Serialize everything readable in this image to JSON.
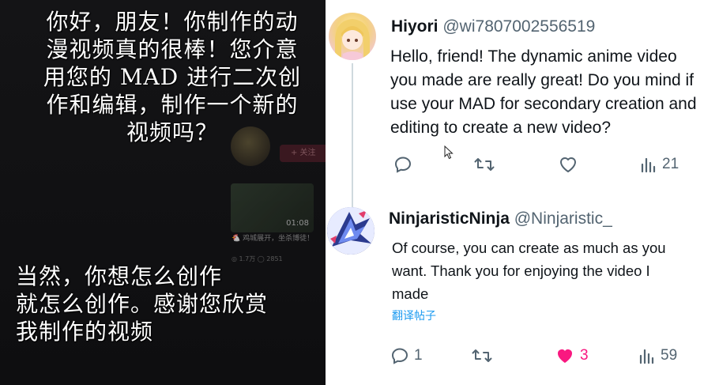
{
  "subtitles": {
    "top": [
      "你好，朋友！你制作的动",
      "漫视频真的很棒！您介意",
      "用您的 MAD 进行二次创",
      "作和编辑，制作一个新的",
      "视频吗？"
    ],
    "bottom": [
      "当然，你想怎么创作",
      "就怎么创作。感谢您欣赏",
      "我制作的视频"
    ]
  },
  "background_ui": {
    "follow_label": "+ 关注",
    "video_duration": "01:08",
    "video_title": "🐔 鸡城展开，坐杀博徒！",
    "video_meta": "◎ 1.7万  ◯ 2851"
  },
  "tweets": [
    {
      "name": "Hiyori",
      "handle": "@wi7807002556519",
      "lines": [
        "Hello, friend!   The dynamic anime video",
        "you made are really great! Do you mind if",
        "use your MAD for secondary creation and",
        "editing to create a new video?"
      ],
      "actions": {
        "reply": "",
        "retweet": "",
        "like": "",
        "views": "21"
      },
      "like_active": false
    },
    {
      "name": "NinjaristicNinja",
      "handle": "@Ninjaristic_",
      "lines": [
        "Of course, you can create as much as you",
        "want. Thank you for enjoying the video I",
        "made"
      ],
      "translate_label": "翻译帖子",
      "actions": {
        "reply": "1",
        "retweet": "",
        "like": "3",
        "views": "59"
      },
      "like_active": true
    }
  ],
  "colors": {
    "accent": "#1d9bf0",
    "like": "#f91880",
    "muted": "#536471"
  },
  "icons": [
    "reply-icon",
    "retweet-icon",
    "like-icon",
    "views-icon"
  ]
}
